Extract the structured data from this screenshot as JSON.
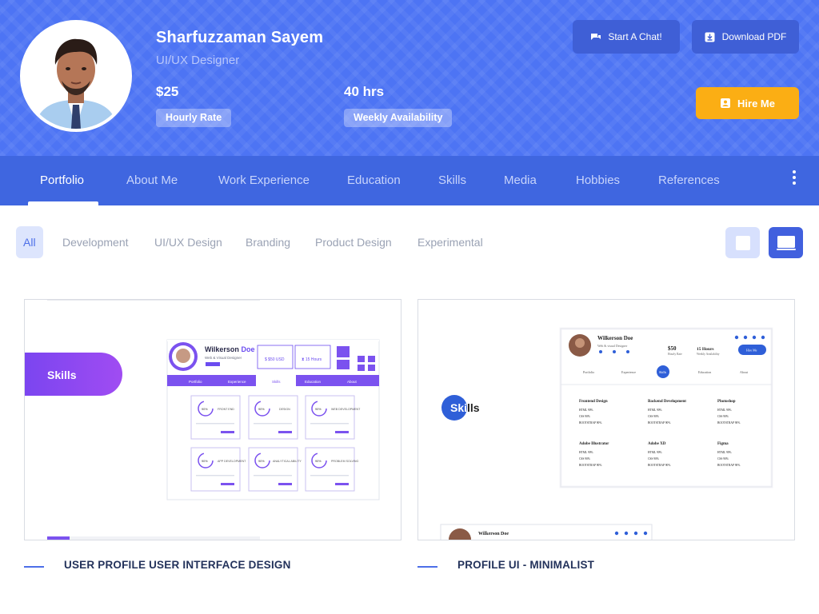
{
  "profile": {
    "name": "Sharfuzzaman Sayem",
    "role": "UI/UX Designer",
    "rate_value": "$25",
    "rate_label": "Hourly Rate",
    "availability_value": "40 hrs",
    "availability_label": "Weekly Availability"
  },
  "actions": {
    "chat_label": "Start A Chat!",
    "pdf_label": "Download PDF",
    "hire_label": "Hire Me"
  },
  "nav": {
    "items": [
      {
        "label": "Portfolio",
        "active": true
      },
      {
        "label": "About Me"
      },
      {
        "label": "Work Experience"
      },
      {
        "label": "Education"
      },
      {
        "label": "Skills"
      },
      {
        "label": "Media"
      },
      {
        "label": "Hobbies"
      },
      {
        "label": "References"
      }
    ]
  },
  "filters": {
    "items": [
      {
        "label": "All",
        "active": true
      },
      {
        "label": "Development"
      },
      {
        "label": "UI/UX Design"
      },
      {
        "label": "Branding"
      },
      {
        "label": "Product Design"
      },
      {
        "label": "Experimental"
      }
    ]
  },
  "cards": [
    {
      "title": "USER PROFILE USER INTERFACE DESIGN",
      "preview": {
        "badge": "Skills",
        "name_first": "Wilkerson",
        "name_last": "Doe",
        "subtitle": "Web & Visual Designer",
        "tabs": [
          "Portfolio",
          "Experience",
          "Skills",
          "Education",
          "About"
        ],
        "skills": [
          "FRONT END",
          "DESIGN",
          "WEB DEVELOPMENT",
          "APP DEVELOPMENT",
          "ANALYTICAL ABILITY",
          "PROBLEM SOLVING"
        ],
        "percents": [
          "90%",
          "90%",
          "90%",
          "90%",
          "90%",
          "90%"
        ]
      }
    },
    {
      "title": "PROFILE UI - MINIMALIST",
      "preview": {
        "badge_left": "Ski",
        "badge_right": "lls",
        "name": "Wilkerson Doe",
        "subtitle": "Web & visual Designer",
        "rate": "$50",
        "rate_label": "Hourly Rate",
        "hours": "15 Hours",
        "hours_label": "Weekly Availability",
        "hire": "Hire Me",
        "tabs": [
          "Portfolio",
          "Experience",
          "Skills",
          "Education",
          "About"
        ],
        "groups": [
          {
            "title": "Frontend Design",
            "rows": [
              "HTML  90%",
              "CSS  90%",
              "BOOTSTRAP  90%"
            ]
          },
          {
            "title": "Backend Development",
            "rows": [
              "HTML  90%",
              "CSS  90%",
              "BOOTSTRAP  90%"
            ]
          },
          {
            "title": "Photoshop",
            "rows": [
              "HTML  90%",
              "CSS  90%",
              "BOOTSTRAP  90%"
            ]
          },
          {
            "title": "Adobe Illustrator",
            "rows": [
              "HTML  90%",
              "CSS  90%",
              "BOOTSTRAP  90%"
            ]
          },
          {
            "title": "Adobe XD",
            "rows": [
              "HTML  90%",
              "CSS  90%",
              "BOOTSTRAP  90%"
            ]
          },
          {
            "title": "Figma",
            "rows": [
              "HTML  90%",
              "CSS  90%",
              "BOOTSTRAP  90%"
            ]
          }
        ],
        "bottom_name": "Wilkerson Doe"
      }
    }
  ],
  "colors": {
    "hero_bg": "#4d74f4",
    "nav_bg": "#3f66e0",
    "hire_button": "#fbae14",
    "accent": "#4d6fe8",
    "title_text": "#23325b"
  },
  "icons": {
    "chat": "chat-bubble-icon",
    "pdf": "download-icon",
    "hire": "user-badge-icon",
    "more": "more-vertical-icon",
    "grid_view": "grid-view-icon",
    "list_view": "list-view-icon"
  }
}
